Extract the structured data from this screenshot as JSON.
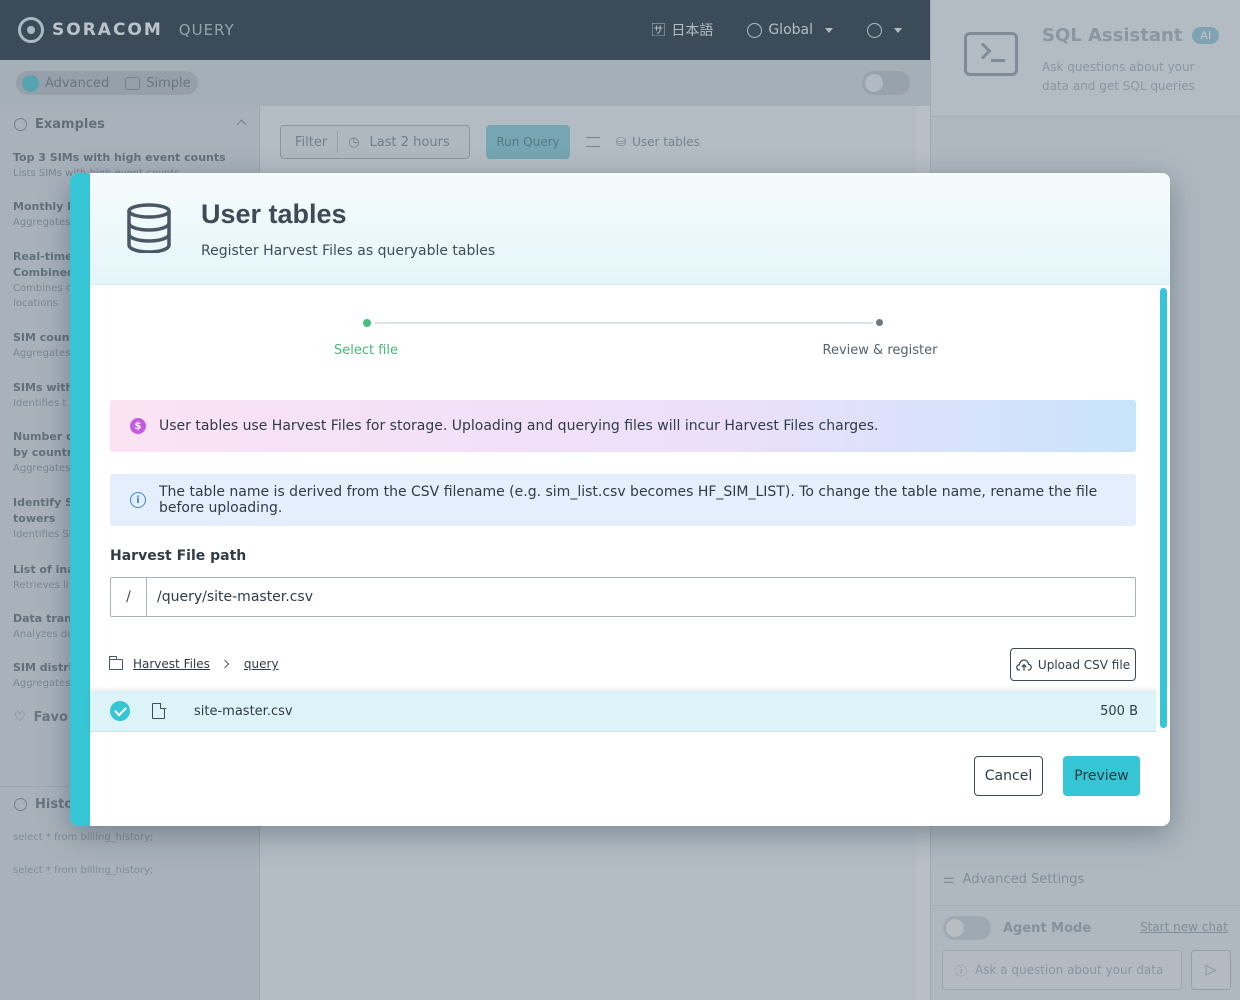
{
  "app": {
    "logo_text": "SORACOM",
    "logo_sub": "QUERY",
    "language": "日本語",
    "region": "Global"
  },
  "mode": {
    "advanced": "Advanced",
    "simple": "Simple"
  },
  "sidebar": {
    "examples_title": "Examples",
    "items": [
      {
        "title": "Top 3 SIMs with high event counts",
        "desc": "Lists SIMs with high event counts"
      },
      {
        "title": "Monthly b",
        "desc": "Aggregates"
      },
      {
        "title": "Real-time",
        "title2": "Combined",
        "desc": "Combines c",
        "desc2": "locations"
      },
      {
        "title": "SIM count",
        "desc": "Aggregates"
      },
      {
        "title": "SIMs with",
        "desc": "Identifies t"
      },
      {
        "title": "Number o",
        "title2": "by country",
        "desc": "Aggregates"
      },
      {
        "title": "Identify SI",
        "title2": "towers",
        "desc": "Identifies SI"
      },
      {
        "title": "List of ina",
        "desc": "Retrieves li"
      },
      {
        "title": "Data trans",
        "desc": "Analyzes da"
      },
      {
        "title": "SIM distri",
        "desc": "Aggregates"
      }
    ],
    "favorites_title": "Favo",
    "history_title": "Histo",
    "history_items": [
      "select * from billing_history;",
      "select * from billing_history;"
    ]
  },
  "toolbar": {
    "filter": "Filter",
    "time_range": "Last 2 hours",
    "run_query": "Run Query",
    "user_tables": "User tables"
  },
  "assistant": {
    "title": "SQL Assistant",
    "badge": "AI",
    "description": "Ask questions about your data and get SQL queries",
    "advanced_settings": "Advanced Settings",
    "agent_mode": "Agent Mode",
    "start_new_chat": "Start new chat",
    "input_placeholder": "Ask a question about your data"
  },
  "modal": {
    "title": "User tables",
    "subtitle": "Register Harvest Files as queryable tables",
    "steps": [
      {
        "label": "Select file",
        "state": "active"
      },
      {
        "label": "Review & register",
        "state": "pending"
      }
    ],
    "billing_notice": "User tables use Harvest Files for storage. Uploading and querying files will incur Harvest Files charges.",
    "info_notice": "The table name is derived from the CSV filename (e.g. sim_list.csv becomes HF_SIM_LIST). To change the table name, rename the file before uploading.",
    "path_label": "Harvest File path",
    "path_prefix": "/",
    "path_value": "/query/site-master.csv",
    "breadcrumb": [
      "Harvest Files",
      "query"
    ],
    "upload_label": "Upload CSV file",
    "files": [
      {
        "name": "site-master.csv",
        "size": "500 B",
        "selected": true
      }
    ],
    "cancel_label": "Cancel",
    "preview_label": "Preview"
  },
  "colors": {
    "accent": "#36c5d4",
    "step_active": "#47c17e",
    "billing_icon": "#c65be0",
    "info_icon": "#3a86e0"
  },
  "icons": {
    "modal": "database-icon",
    "billing": "dollar-icon",
    "info": "info-icon",
    "folder": "folder-icon",
    "upload": "cloud-upload-icon",
    "file": "file-icon",
    "selected": "check-circle-icon"
  }
}
